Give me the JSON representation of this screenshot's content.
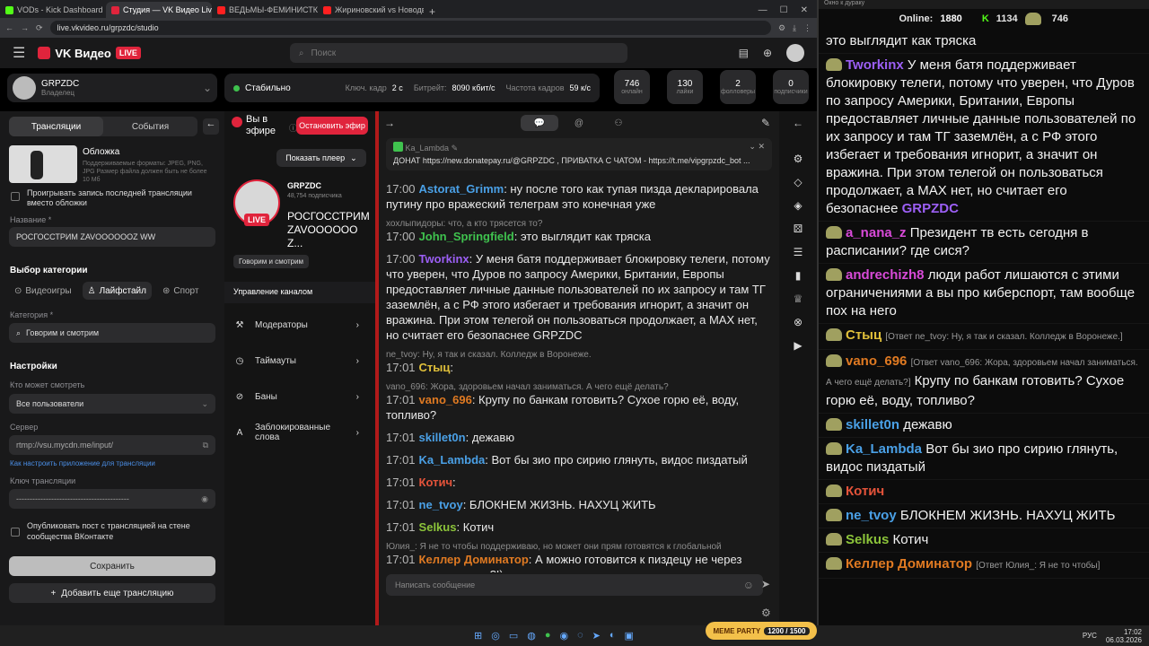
{
  "tabs": [
    {
      "label": "VODs - Kick Dashboard",
      "color": "#53fc18"
    },
    {
      "label": "Студия — VK Видео Live",
      "color": "#e0243c"
    },
    {
      "label": "ВЕДЬМЫ-ФЕМИНИСТКИ ПРОТ",
      "color": "#ff2020"
    },
    {
      "label": "Жириновский vs Новодворск",
      "color": "#ff2020"
    }
  ],
  "url": "live.vkvideo.ru/grpzdc/studio",
  "brand": {
    "name": "VK Видео",
    "badge": "LIVE"
  },
  "search_placeholder": "Поиск",
  "channel": {
    "name": "GRPZDC",
    "role": "Владелец"
  },
  "status": {
    "label": "Стабильно",
    "keyframe_label": "Ключ. кадр",
    "keyframe": "2 с",
    "bitrate_label": "Битрейт:",
    "bitrate": "8090 кбит/с",
    "fps_label": "Частота кадров",
    "fps": "59 к/с"
  },
  "stats": [
    {
      "n": "746",
      "t": "онлайн"
    },
    {
      "n": "130",
      "t": "лайки"
    },
    {
      "n": "2",
      "t": "фолловеры"
    },
    {
      "n": "0",
      "t": "подписчики"
    }
  ],
  "left": {
    "tab_streams": "Трансляции",
    "tab_events": "События",
    "cover_title": "Обложка",
    "cover_desc": "Поддерживаемые форматы: JPEG, PNG, JPG Размер файла должен быть не более 10 Мб",
    "replay_label": "Проигрывать запись последней трансляции вместо обложки",
    "name_label": "Название *",
    "name_value": "РОСГОССТРИМ ZAVOOOOOOZ WW",
    "cat_section": "Выбор категории",
    "cat_games": "Видеоигры",
    "cat_life": "Лайфстайл",
    "cat_sport": "Спорт",
    "category_label": "Категория *",
    "category_value": "Говорим и смотрим",
    "settings": "Настройки",
    "who_label": "Кто может смотреть",
    "who_value": "Все пользователи",
    "server_label": "Сервер",
    "server_value": "rtmp://vsu.mycdn.me/input/",
    "howto": "Как настроить приложение для трансляции",
    "key_label": "Ключ трансляции",
    "key_value": "------------------------------------------",
    "publish_label": "Опубликовать пост с трансляцией на стене сообщества ВКонтакте",
    "save": "Сохранить",
    "add": "Добавить еще трансляцию"
  },
  "mid": {
    "on_air": "Вы в эфире",
    "stop": "Остановить эфир",
    "show_player": "Показать плеер",
    "ch_name": "GRPZDC",
    "ch_subs": "48,754 подписчика",
    "stream_title": "РОСГОССТРИМ ZAVOOOOOOZ...",
    "category_tag": "Говорим и смотрим",
    "manage": "Управление каналом",
    "nav": [
      "Модераторы",
      "Таймауты",
      "Баны",
      "Заблокированные слова"
    ]
  },
  "chat": {
    "pinned_user": "Ka_Lambda",
    "pinned_text": "ДОНАТ https://new.donatepay.ru/@GRPZDC , ПРИВАТКА С ЧАТОМ - https://t.me/vipgrpzdc_bot ...",
    "placeholder": "Написать сообщение",
    "messages": [
      {
        "time": "17:00",
        "user": "Astorat_Grimm",
        "cls": "u-blue",
        "text": "ну после того как тупая пизда декларировала путину про вражеский телеграм это конечная уже"
      },
      {
        "reply": "хохлыпидоры: что, а кто трясется то?",
        "time": "17:00",
        "user": "John_Springfield",
        "cls": "u-green",
        "text": "это выглядит как тряска"
      },
      {
        "time": "17:00",
        "user": "Tworkinx",
        "cls": "u-purple",
        "text": "У меня батя поддерживает блокировку телеги, потому что уверен, что Дуров по запросу Америки, Британии, Европы предоставляет личные данные пользователей по их запросу и там ТГ заземлён, а с РФ этого избегает и требования игнорит, а значит он вражина. При этом телегой он пользоваться продолжает, а MAX нет, но считает его безопаснее GRPZDC"
      },
      {
        "reply": "ne_tvoy: Ну, я так и сказал. Колледж в Воронеже.",
        "time": "17:01",
        "user": "Стыц",
        "cls": "u-yellow",
        "text": ""
      },
      {
        "reply": "vano_696: Жора, здоровьем начал заниматься. А чего ещё делать?",
        "time": "17:01",
        "user": "vano_696",
        "cls": "u-orange",
        "text": "Крупу по банкам готовить? Сухое горю её, воду, топливо?"
      },
      {
        "time": "17:01",
        "user": "skillet0n",
        "cls": "u-blue",
        "text": "дежавю"
      },
      {
        "time": "17:01",
        "user": "Ka_Lambda",
        "cls": "u-blue",
        "text": "Вот бы зио про сирию глянуть, видос пиздатый"
      },
      {
        "time": "17:01",
        "user": "Котич",
        "cls": "u-red",
        "text": ""
      },
      {
        "time": "17:01",
        "user": "ne_tvoy",
        "cls": "u-blue",
        "text": "БЛОКНЕМ ЖИЗНЬ. НАХУЦ ЖИТЬ"
      },
      {
        "time": "17:01",
        "user": "Selkus",
        "cls": "u-lime",
        "text": "Котич"
      },
      {
        "reply": "Юлия_: Я не то чтобы поддерживаю, но может они прям готовятся к глобальной",
        "time": "17:01",
        "user": "Келлер Доминатор",
        "cls": "u-orange",
        "text": "А можно готовится к пиздецу не через жопу, по навиопски?!)"
      }
    ]
  },
  "overlay": {
    "title": "Окно к дураку",
    "online_label": "Online:",
    "online": "1880",
    "kick": "1134",
    "vk": "746",
    "top_text": "это выглядит как тряска",
    "messages": [
      {
        "user": "Tworkinx",
        "cls": "u-purple",
        "text": "У меня батя поддерживает блокировку телеги, потому что уверен, что Дуров по запросу Америки, Британии, Европы предоставляет личные данные пользователей по их запросу и там ТГ заземлён, а с РФ этого избегает и требования игнорит, а значит он вражина. При этом телегой он пользоваться продолжает, а MAX нет, но считает его безопаснее",
        "tag": "GRPZDC"
      },
      {
        "user": "a_nana_z",
        "cls": "u-magenta",
        "text": "Президент тв есть сегодня в расписании? где сися?"
      },
      {
        "user": "andrechizh8",
        "cls": "u-magenta",
        "text": "люди работ лишаются с этими ограничениями а вы про киберспорт, там вообще пох на него"
      },
      {
        "user": "Стыц",
        "cls": "u-yellow",
        "reply": "[Ответ ne_tvoy: Ну, я так и сказал. Колледж в Воронеже.]",
        "text": ""
      },
      {
        "user": "vano_696",
        "cls": "u-orange",
        "reply": "[Ответ vano_696: Жора, здоровьем начал заниматься. А чего ещё делать?]",
        "text": "Крупу по банкам готовить? Сухое горю её, воду, топливо?"
      },
      {
        "user": "skillet0n",
        "cls": "u-blue",
        "text": "дежавю"
      },
      {
        "user": "Ka_Lambda",
        "cls": "u-blue",
        "text": "Вот бы зио про сирию глянуть, видос пиздатый"
      },
      {
        "user": "Котич",
        "cls": "u-red",
        "text": ""
      },
      {
        "user": "ne_tvoy",
        "cls": "u-blue",
        "text": "БЛОКНЕМ ЖИЗНЬ. НАХУЦ ЖИТЬ"
      },
      {
        "user": "Selkus",
        "cls": "u-lime",
        "text": "Котич"
      },
      {
        "user": "Келлер Доминатор",
        "cls": "u-orange",
        "reply": "[Ответ Юлия_: Я не то чтобы]",
        "text": ""
      }
    ]
  },
  "taskbar": {
    "lang": "РУС",
    "time": "17:02",
    "date": "06.03.2026",
    "widget": "MEME PARTY",
    "widget_value": "1200 / 1500"
  }
}
